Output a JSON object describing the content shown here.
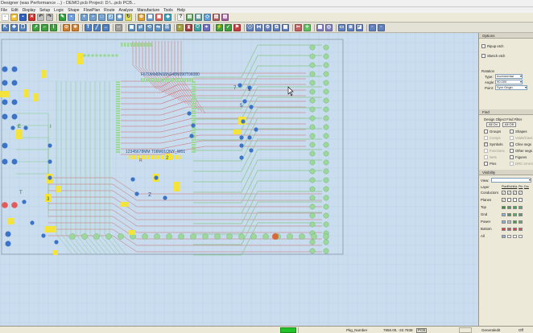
{
  "window": {
    "title": "Designer (was Performance ...) - DEMO.pcb   Project: D:\\...pcb PCB..."
  },
  "menu": [
    "File",
    "Edit",
    "Display",
    "Setup",
    "Logic",
    "Shape",
    "FlowPlan",
    "Route",
    "Analyze",
    "Manufacture",
    "Tools",
    "Help"
  ],
  "canvas": {
    "labels": {
      "net_bus": "F6T0MM8N08N048N090T06080",
      "net_bus2": "12345678MM T08M01ONY_W01",
      "ref_r": "R",
      "ref_2": "2",
      "ref_7": "7",
      "ref_1": "1",
      "ref_5": "5",
      "ref_e": "E",
      "ref_i": "I",
      "ref_t": "T",
      "ref_3": "3",
      "ref_2b": "2"
    },
    "colors": {
      "background": "#c9ddee",
      "trace_red": "#d06a6a",
      "trace_green": "#86c88a",
      "pad_green": "#9bd89a",
      "pad_blue": "#3a73c8",
      "pad_yellow": "#f3e33a",
      "pad_red": "#e35a5a",
      "pad_orange": "#d8683a",
      "grid": "#a8c4de"
    }
  },
  "panel": {
    "options": {
      "header": "Options",
      "ripup": "Ripup etch",
      "sketch": "Sketch etch"
    },
    "rotation": {
      "header": "Rotation",
      "type_label": "Type:",
      "type_value": "Incremental",
      "angle_label": "Angle:",
      "angle_value": "90.000",
      "point_label": "Point:",
      "point_value": "Sym Origin"
    },
    "find": {
      "header": "Find",
      "filter_label": "Design Object Find Filter",
      "all_on": "All On",
      "all_off": "All Off",
      "left": [
        {
          "label": "Groups",
          "checked": false,
          "dim": false
        },
        {
          "label": "Comps",
          "checked": false,
          "dim": true
        },
        {
          "label": "Symbols",
          "checked": true,
          "dim": false
        },
        {
          "label": "Functions",
          "checked": false,
          "dim": true
        },
        {
          "label": "Nets",
          "checked": false,
          "dim": true
        },
        {
          "label": "Pins",
          "checked": false,
          "dim": false
        }
      ],
      "right": [
        {
          "label": "Shapes",
          "checked": false,
          "dim": false
        },
        {
          "label": "Voids/Cavs",
          "checked": false,
          "dim": true
        },
        {
          "label": "Cline segs",
          "checked": false,
          "dim": false
        },
        {
          "label": "Other segs",
          "checked": false,
          "dim": false
        },
        {
          "label": "Figures",
          "checked": false,
          "dim": false
        },
        {
          "label": "DRC errors",
          "checked": false,
          "dim": true
        }
      ]
    },
    "visibility": {
      "header": "Visibility",
      "view_label": "View:",
      "layer_label": "Layer",
      "columns": [
        "Plan",
        "Etch",
        "Via",
        "Pin",
        "Drc"
      ],
      "rows": [
        {
          "name": "Conductors",
          "colors": [
            "#ffffff",
            "#ffffff",
            "#ffffff",
            "#ffffff"
          ],
          "checks": [
            true,
            true,
            true,
            true
          ]
        },
        {
          "name": "Planes",
          "colors": [
            "#ffffff",
            "#ffffff",
            "#ffffff",
            "#ffffff"
          ],
          "checks": [
            true,
            false,
            false,
            false
          ]
        },
        {
          "name": "Top",
          "colors": [
            "#3a8c3a",
            "#4a9c4a",
            "#4aa04a",
            "#58b058"
          ],
          "checks": []
        },
        {
          "name": "Gnd",
          "colors": [
            "#8fb0d8",
            "#4a9c4a",
            "#58b058",
            "#5aa05a"
          ],
          "checks": []
        },
        {
          "name": "Power",
          "colors": [
            "#8fb0d8",
            "#c0c0c0",
            "#4a9c4a",
            "#58b058"
          ],
          "checks": []
        },
        {
          "name": "Bottom",
          "colors": [
            "#d04040",
            "#d05050",
            "#c04848",
            "#d85050"
          ],
          "checks": []
        },
        {
          "name": "All",
          "colors": [
            "#8fb0d8",
            "#ffffff",
            "#ffffff",
            "#ffffff"
          ],
          "checks": []
        }
      ]
    }
  },
  "status": {
    "mode": "Pkg_Number",
    "coords": "7856.00, -22.7838",
    "pcb": "PCB",
    "cmd": "Generaledit",
    "off": "Off"
  }
}
